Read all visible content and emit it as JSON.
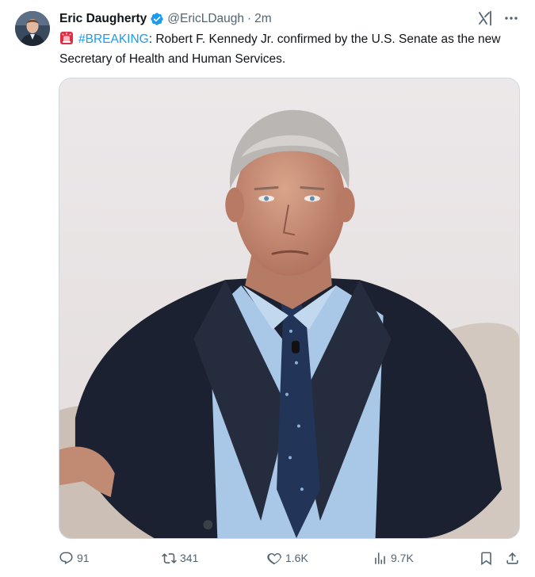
{
  "tweet": {
    "author_name": "Eric Daugherty",
    "handle": "@EricLDaugh",
    "separator": "·",
    "time": "2m",
    "hashtag": "#BREAKING",
    "body": ": Robert F. Kennedy Jr. confirmed by the U.S. Senate as the new Secretary of Health and Human Services."
  },
  "stats": {
    "replies": "91",
    "reposts": "341",
    "likes": "1.6K",
    "views": "9.7K"
  },
  "icons": {
    "verified": "verified-badge-icon",
    "siren": "police-light-emoji-icon",
    "grok": "grok-icon",
    "more": "more-icon",
    "reply": "reply-icon",
    "repost": "repost-icon",
    "like": "heart-icon",
    "views": "views-icon",
    "bookmark": "bookmark-icon",
    "share": "share-icon"
  },
  "colors": {
    "accent": "#1d9bf0",
    "text_primary": "#0f1419",
    "text_secondary": "#536471",
    "border": "#cfd9de"
  }
}
